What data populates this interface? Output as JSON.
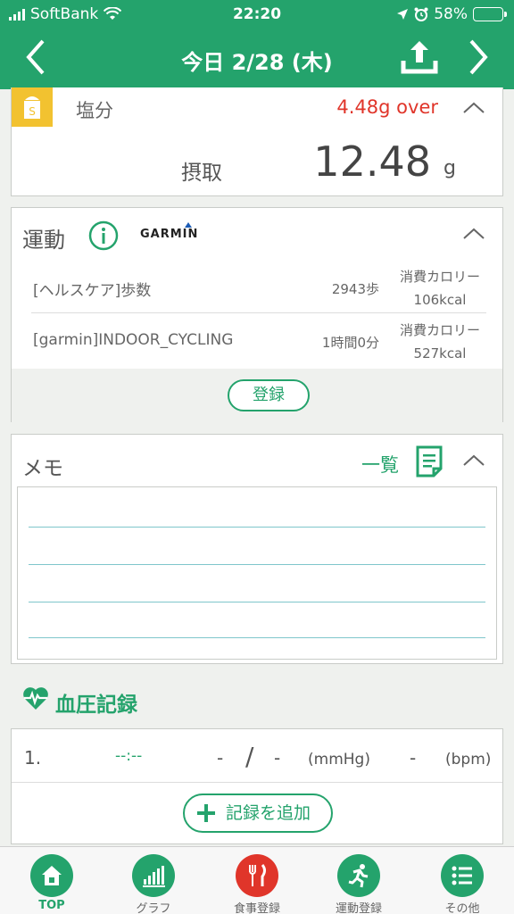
{
  "status": {
    "carrier": "SoftBank",
    "time": "22:20",
    "battery": "58%",
    "battery_level": 0.58
  },
  "nav": {
    "title": "今日 2/28 (木)"
  },
  "salt": {
    "label": "塩分",
    "over": "4.48g over",
    "intake_label": "摂取",
    "value": "12.48",
    "unit": "g"
  },
  "exercise": {
    "title": "運動",
    "brand": "GARMIN",
    "rows": [
      {
        "name": "[ヘルスケア]歩数",
        "amount": "2943歩",
        "cal_label": "消費カロリー",
        "cal": "106kcal"
      },
      {
        "name": "[garmin]INDOOR_CYCLING",
        "amount": "1時間0分",
        "cal_label": "消費カロリー",
        "cal": "527kcal"
      }
    ],
    "register": "登録"
  },
  "memo": {
    "title": "メモ",
    "list_link": "一覧"
  },
  "bp": {
    "title": "血圧記録",
    "row": {
      "num": "1.",
      "time": "--:--",
      "sys": "-",
      "slash": "/",
      "dia": "-",
      "unit_mmhg": "(mmHg)",
      "pulse": "-",
      "unit_bpm": "(bpm)"
    },
    "add": "記録を追加"
  },
  "tabs": [
    {
      "label": "TOP",
      "icon": "home-icon"
    },
    {
      "label": "グラフ",
      "icon": "bar-chart-icon"
    },
    {
      "label": "食事登録",
      "icon": "fork-knife-icon"
    },
    {
      "label": "運動登録",
      "icon": "runner-icon"
    },
    {
      "label": "その他",
      "icon": "list-icon"
    }
  ],
  "colors": {
    "primary": "#24a36c",
    "alert": "#e0352a",
    "salt": "#f2c230"
  }
}
